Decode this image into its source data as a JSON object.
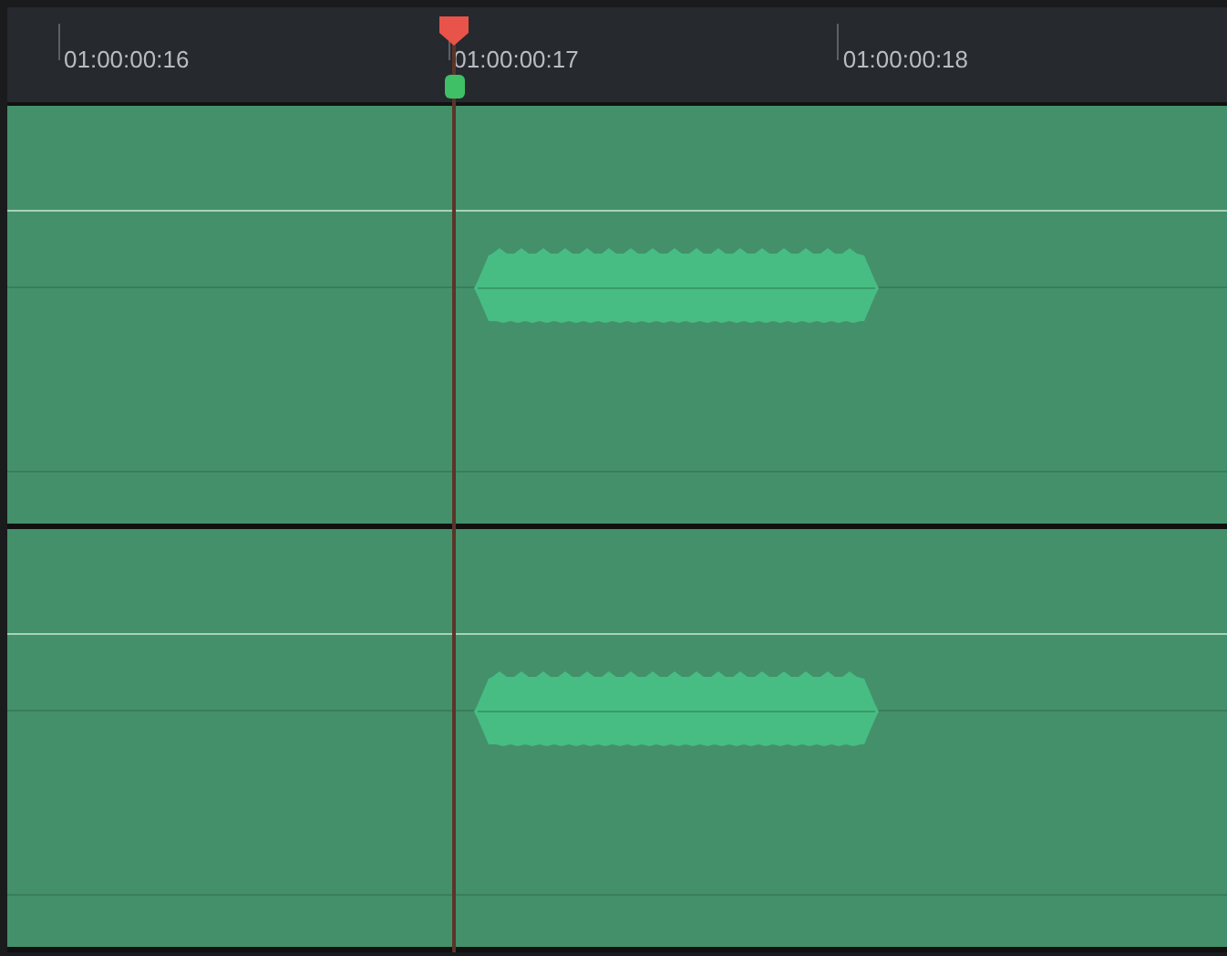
{
  "ruler": {
    "timecodes": [
      "01:00:00:16",
      "01:00:00:17",
      "01:00:00:18"
    ]
  },
  "tracks": [
    {
      "kind": "audio"
    },
    {
      "kind": "audio"
    }
  ]
}
